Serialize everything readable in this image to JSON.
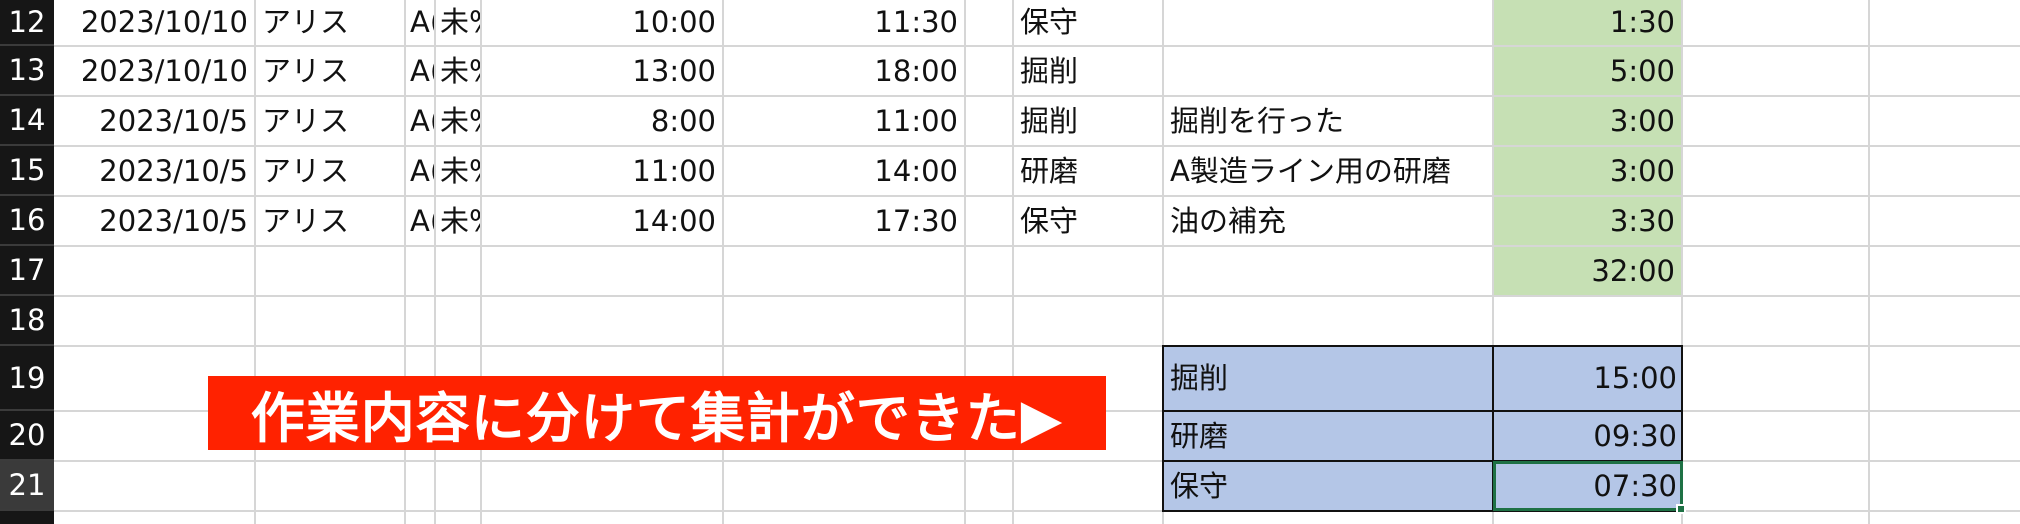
{
  "colors": {
    "header_bg": "#161616",
    "green_fill": "#c6e0b4",
    "blue_fill": "#b4c6e7",
    "banner_bg": "#ff2200",
    "selection": "#1e7145"
  },
  "row_numbers": [
    "12",
    "13",
    "14",
    "15",
    "16",
    "17",
    "18",
    "19",
    "20",
    "21"
  ],
  "rows": [
    {
      "date": "2023/10/10",
      "name": "アリス",
      "c": "A(",
      "status": "未%",
      "start": "10:00",
      "end": "11:30",
      "task": "保守",
      "note": "",
      "hours": "1:30"
    },
    {
      "date": "2023/10/10",
      "name": "アリス",
      "c": "A(",
      "status": "未%",
      "start": "13:00",
      "end": "18:00",
      "task": "掘削",
      "note": "",
      "hours": "5:00"
    },
    {
      "date": "2023/10/5",
      "name": "アリス",
      "c": "A(",
      "status": "未%",
      "start": "8:00",
      "end": "11:00",
      "task": "掘削",
      "note": "掘削を行った",
      "hours": "3:00"
    },
    {
      "date": "2023/10/5",
      "name": "アリス",
      "c": "A(",
      "status": "未%",
      "start": "11:00",
      "end": "14:00",
      "task": "研磨",
      "note": "A製造ライン用の研磨",
      "hours": "3:00"
    },
    {
      "date": "2023/10/5",
      "name": "アリス",
      "c": "A(",
      "status": "未%",
      "start": "14:00",
      "end": "17:30",
      "task": "保守",
      "note": "油の補充",
      "hours": "3:30"
    }
  ],
  "total": "32:00",
  "summary": [
    {
      "task": "掘削",
      "hours": "15:00"
    },
    {
      "task": "研磨",
      "hours": "09:30"
    },
    {
      "task": "保守",
      "hours": "07:30"
    }
  ],
  "banner_text": "作業内容に分けて集計ができた▶"
}
